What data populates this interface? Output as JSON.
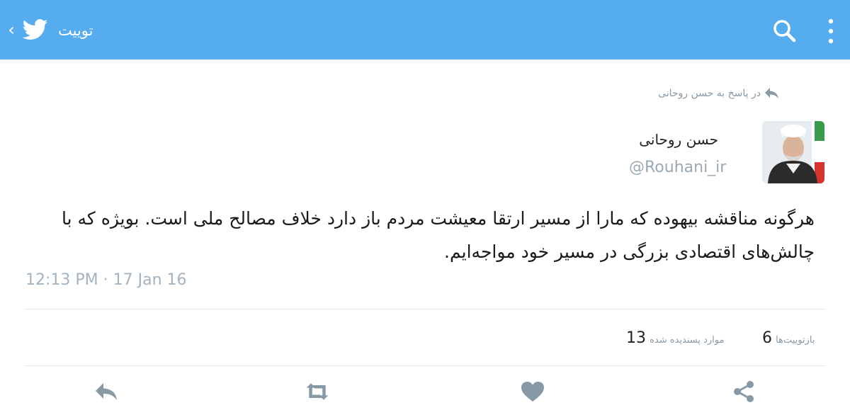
{
  "appbar": {
    "title": "توییت",
    "back_icon": "chevron-left-icon",
    "logo_icon": "twitter-bird-icon",
    "search_icon": "search-icon",
    "more_icon": "more-vertical-icon",
    "bar_color": "#55acee"
  },
  "tweet": {
    "reply_context": "در پاسخ به حسن روحانی",
    "author_name": "حسن روحانی",
    "author_handle": "@Rouhani_ir",
    "text_line1": "هرگونه مناقشه بیهوده که مارا از مسیر ارتقا معیشت مردم باز دارد خلاف مصالح ملی است. بویژه که با",
    "text_line2": "چالش‌های اقتصادی بزرگی در مسیر خود مواجه‌ایم.",
    "timestamp": "12:13 PM · 17 Jan 16"
  },
  "stats": {
    "retweets_count": "6",
    "retweets_label": "بازتوییت‌ها",
    "likes_count": "13",
    "likes_label": "موارد پسندیده شده"
  },
  "actions": {
    "reply_icon": "reply-icon",
    "retweet_icon": "retweet-icon",
    "like_icon": "heart-icon",
    "share_icon": "share-icon"
  }
}
